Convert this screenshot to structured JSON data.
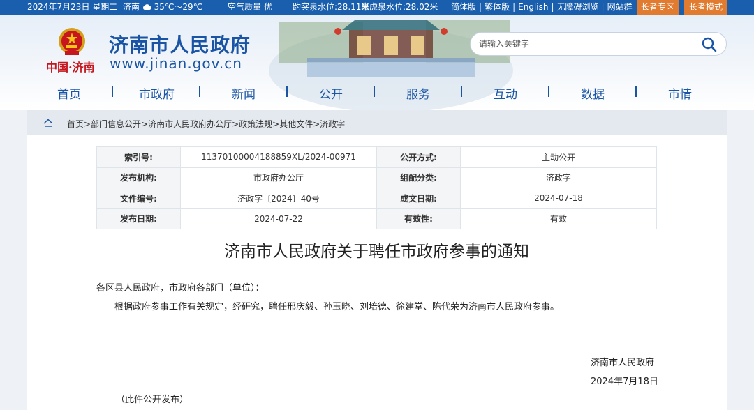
{
  "topbar": {
    "date": "2024年7月23日 星期二",
    "city": "济南",
    "temperature": "35℃～29℃",
    "air": "空气质量 优",
    "spring1": "趵突泉水位:28.11米",
    "spring2": "黑虎泉水位:28.02米",
    "lang_simplified": "简体版",
    "lang_traditional": "繁体版",
    "lang_english": "English",
    "accessible": "无障碍浏览",
    "sites": "网站群",
    "elder_zone": "长者专区",
    "elder_mode": "长者模式",
    "separator": "|"
  },
  "header": {
    "site_name": "济南市人民政府",
    "site_url": "www.jinan.gov.cn",
    "brand": "中国·济南",
    "search_placeholder": "请输入关键字"
  },
  "nav": {
    "items": [
      "首页",
      "市政府",
      "新闻",
      "公开",
      "服务",
      "互动",
      "数据",
      "市情"
    ]
  },
  "breadcrumb": {
    "path": "首页>部门信息公开>济南市人民政府办公厅>政策法规>其他文件>济政字"
  },
  "meta": {
    "index_label": "索引号:",
    "index_value": "11370100004188859XL/2024-00971",
    "open_label": "公开方式:",
    "open_value": "主动公开",
    "issuer_label": "发布机构:",
    "issuer_value": "市政府办公厅",
    "category_label": "组配分类:",
    "category_value": "济政字",
    "docno_label": "文件编号:",
    "docno_value": "济政字〔2024〕40号",
    "created_label": "成文日期:",
    "created_value": "2024-07-18",
    "published_label": "发布日期:",
    "published_value": "2024-07-22",
    "validity_label": "有效性:",
    "validity_value": "有效"
  },
  "article": {
    "title": "济南市人民政府关于聘任市政府参事的通知",
    "salutation": "各区县人民政府，市政府各部门（单位）：",
    "body": "根据政府参事工作有关规定，经研究，聘任邢庆毅、孙玉晓、刘培德、徐建堂、陈代荣为济南市人民政府参事。",
    "signature": "济南市人民政府",
    "sign_date": "2024年7月18日",
    "note": "（此件公开发布）"
  },
  "colors": {
    "topbar": "#1a5fae",
    "accent": "#1a55a5",
    "orange": "#e07b2f",
    "brand_red": "#c7161d"
  }
}
